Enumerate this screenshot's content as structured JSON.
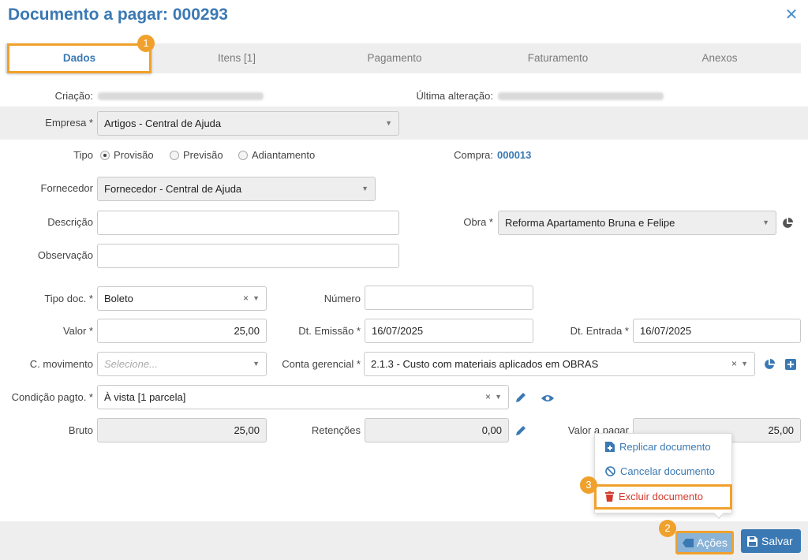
{
  "header": {
    "title": "Documento a pagar: 000293"
  },
  "tabs": [
    "Dados",
    "Itens [1]",
    "Pagamento",
    "Faturamento",
    "Anexos"
  ],
  "badges": [
    "1",
    "2",
    "3"
  ],
  "meta": {
    "creation_label": "Criação:",
    "last_change_label": "Última alteração:"
  },
  "form": {
    "empresa": {
      "label": "Empresa *",
      "value": "Artigos - Central de Ajuda"
    },
    "tipo": {
      "label": "Tipo",
      "options": [
        "Provisão",
        "Previsão",
        "Adiantamento"
      ],
      "selected": "Provisão"
    },
    "compra": {
      "label": "Compra:",
      "value": "000013"
    },
    "fornecedor": {
      "label": "Fornecedor",
      "value": "Fornecedor - Central de Ajuda"
    },
    "descricao": {
      "label": "Descrição",
      "value": ""
    },
    "obra": {
      "label": "Obra *",
      "value": "Reforma Apartamento Bruna e Felipe"
    },
    "observacao": {
      "label": "Observação",
      "value": ""
    },
    "tipo_doc": {
      "label": "Tipo doc. *",
      "value": "Boleto"
    },
    "numero": {
      "label": "Número",
      "value": ""
    },
    "valor": {
      "label": "Valor *",
      "value": "25,00"
    },
    "dt_emissao": {
      "label": "Dt. Emissão *",
      "value": "16/07/2025"
    },
    "dt_entrada": {
      "label": "Dt. Entrada *",
      "value": "16/07/2025"
    },
    "c_movimento": {
      "label": "C. movimento",
      "placeholder": "Selecione..."
    },
    "conta_gerencial": {
      "label": "Conta gerencial *",
      "value": "2.1.3 - Custo com materiais aplicados em OBRAS"
    },
    "condicao": {
      "label": "Condição pagto. *",
      "value": "À vista [1 parcela]"
    },
    "bruto": {
      "label": "Bruto",
      "value": "25,00"
    },
    "retencoes": {
      "label": "Retenções",
      "value": "0,00"
    },
    "valor_pagar": {
      "label": "Valor a pagar",
      "value": "25,00"
    }
  },
  "menu": {
    "items": [
      {
        "label": "Replicar documento",
        "icon": "file-plus-icon"
      },
      {
        "label": "Cancelar documento",
        "icon": "ban-icon"
      },
      {
        "label": "Excluir documento",
        "icon": "trash-icon"
      }
    ]
  },
  "footer": {
    "acoes_label": "Ações",
    "salvar_label": "Salvar"
  },
  "colors": {
    "primary": "#3a79b3",
    "highlight": "#f0a12c",
    "danger": "#d33a2c"
  }
}
